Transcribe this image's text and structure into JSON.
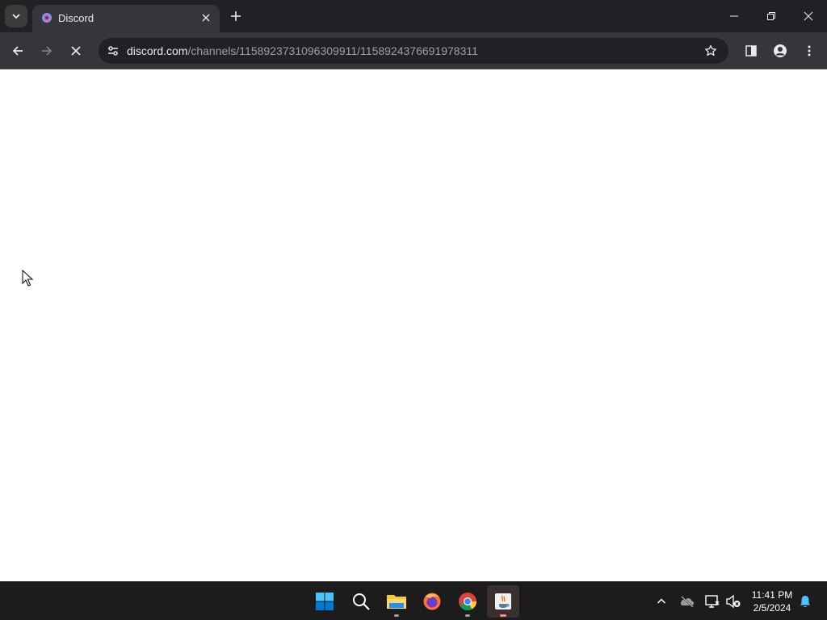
{
  "browser": {
    "tab": {
      "title": "Discord"
    },
    "address_bar": {
      "host": "discord.com",
      "path": "/channels/1158923731096309911/1158924376691978311"
    }
  },
  "taskbar": {
    "apps": [
      "start-icon",
      "search-icon",
      "file-explorer-icon",
      "firefox-icon",
      "chrome-icon",
      "java-icon"
    ],
    "clock": {
      "time": "11:41 PM",
      "date": "2/5/2024"
    }
  },
  "colors": {
    "tabstrip": "#202124",
    "toolbar": "#35363a",
    "taskbar": "#1c1c1c",
    "windows_blue": "#0078d4",
    "notification_bell": "#4cc2ff"
  }
}
